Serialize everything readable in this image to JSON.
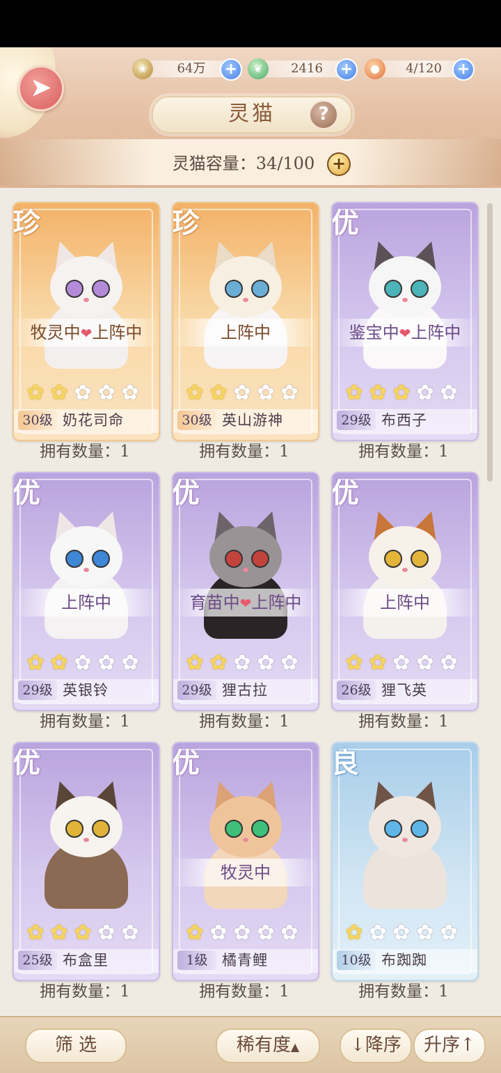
{
  "header": {
    "title": "灵猫",
    "capacity_text": "灵猫容量：34/100",
    "resources": [
      {
        "icon": "paw-coin-icon",
        "value": "64万"
      },
      {
        "icon": "green-bird-icon",
        "value": "2416"
      },
      {
        "icon": "food-bowl-icon",
        "value": "4/120"
      }
    ]
  },
  "cats": [
    {
      "rarity": "珍",
      "status": "牧灵中",
      "status2": "上阵中",
      "heart": "❤",
      "stars": 2,
      "level": "30级",
      "name": "奶花司命",
      "count": "拥有数量：1"
    },
    {
      "rarity": "珍",
      "status": "上阵中",
      "status2": "",
      "heart": "",
      "stars": 2,
      "level": "30级",
      "name": "英山游神",
      "count": "拥有数量：1"
    },
    {
      "rarity": "优",
      "status": "鉴宝中",
      "status2": "上阵中",
      "heart": "❤",
      "stars": 3,
      "level": "29级",
      "name": "布西子",
      "count": "拥有数量：1"
    },
    {
      "rarity": "优",
      "status": "上阵中",
      "status2": "",
      "heart": "",
      "stars": 2,
      "level": "29级",
      "name": "英银铃",
      "count": "拥有数量：1"
    },
    {
      "rarity": "优",
      "status": "育苗中",
      "status2": "上阵中",
      "heart": "❤",
      "stars": 2,
      "level": "29级",
      "name": "狸古拉",
      "count": "拥有数量：1"
    },
    {
      "rarity": "优",
      "status": "上阵中",
      "status2": "",
      "heart": "",
      "stars": 2,
      "level": "26级",
      "name": "狸飞英",
      "count": "拥有数量：1"
    },
    {
      "rarity": "优",
      "status": "",
      "status2": "",
      "heart": "",
      "stars": 3,
      "level": "25级",
      "name": "布盒里",
      "count": "拥有数量：1"
    },
    {
      "rarity": "优",
      "status": "牧灵中",
      "status2": "",
      "heart": "",
      "stars": 1,
      "level": "1级",
      "name": "橘青鲤",
      "count": "拥有数量：1"
    },
    {
      "rarity": "良",
      "status": "",
      "status2": "",
      "heart": "",
      "stars": 1,
      "level": "10级",
      "name": "布踟踟",
      "count": "拥有数量：1"
    }
  ],
  "footer": {
    "filter_label": "筛 选",
    "sort_label": "稀有度",
    "sort_arrow": "▲",
    "desc_label": "↓降序",
    "asc_label": "升序↑"
  },
  "colors": {
    "accent": "#d9605f",
    "plus_blue": "#4a82e6",
    "purple_card": "#cdbbe9",
    "gold_card": "#f2c78f",
    "blue_card": "#bcd9ee"
  }
}
